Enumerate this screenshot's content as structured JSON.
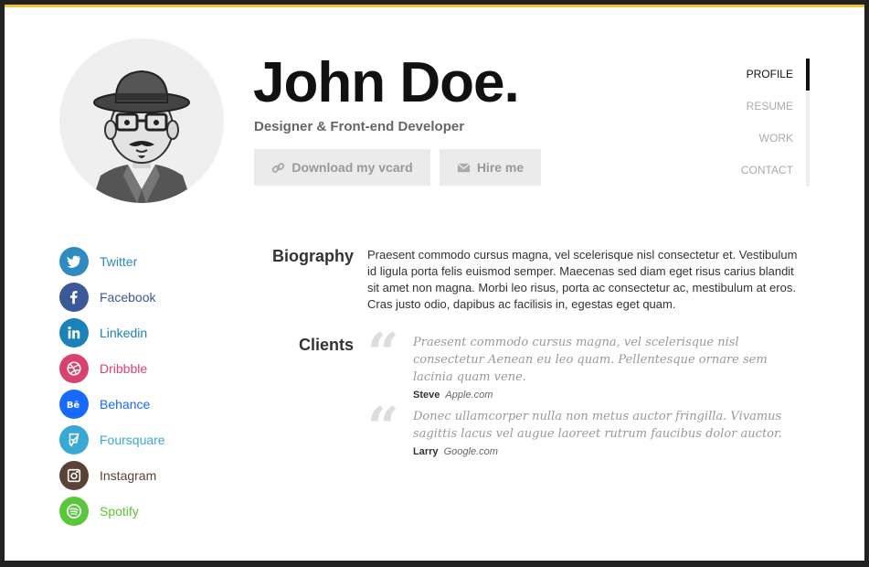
{
  "header": {
    "name": "John Doe.",
    "tagline": "Designer & Front-end Developer",
    "download_label": "Download my vcard",
    "hire_label": "Hire me"
  },
  "nav": {
    "items": [
      "PROFILE",
      "RESUME",
      "WORK",
      "CONTACT"
    ],
    "active": "PROFILE"
  },
  "social": [
    {
      "label": "Twitter",
      "icon": "twitter-icon",
      "color": "#2e8bc0"
    },
    {
      "label": "Facebook",
      "icon": "facebook-icon",
      "color": "#3b5998"
    },
    {
      "label": "Linkedin",
      "icon": "linkedin-icon",
      "color": "#1a82b8"
    },
    {
      "label": "Dribbble",
      "icon": "dribbble-icon",
      "color": "#d9426f"
    },
    {
      "label": "Behance",
      "icon": "behance-icon",
      "color": "#1769ff"
    },
    {
      "label": "Foursquare",
      "icon": "foursquare-icon",
      "color": "#3aa8d4"
    },
    {
      "label": "Instagram",
      "icon": "instagram-icon",
      "color": "#5b4236"
    },
    {
      "label": "Spotify",
      "icon": "spotify-icon",
      "color": "#5ac63a"
    }
  ],
  "biography": {
    "title": "Biography",
    "text": "Praesent commodo cursus magna, vel scelerisque nisl consectetur et. Vestibulum id ligula porta felis euismod semper. Maecenas sed diam eget risus carius blandit sit amet non magna. Morbi leo risus, porta ac consectetur ac, mestibulum at eros. Cras justo odio, dapibus ac facilisis in, egestas eget quam."
  },
  "clients": {
    "title": "Clients",
    "quotes": [
      {
        "text": "Praesent commodo cursus magna, vel scelerisque nisl consectetur Aenean eu leo quam. Pellentesque ornare sem lacinia quam vene.",
        "author": "Steve",
        "company": "Apple.com"
      },
      {
        "text": "Donec ullamcorper nulla non metus auctor fringilla. Vivamus sagittis lacus vel augue laoreet rutrum faucibus dolor auctor.",
        "author": "Larry",
        "company": "Google.com"
      }
    ]
  },
  "colors": {
    "accent": "#f2c233",
    "button_bg": "#ebebeb",
    "nav_active": "#111111"
  }
}
